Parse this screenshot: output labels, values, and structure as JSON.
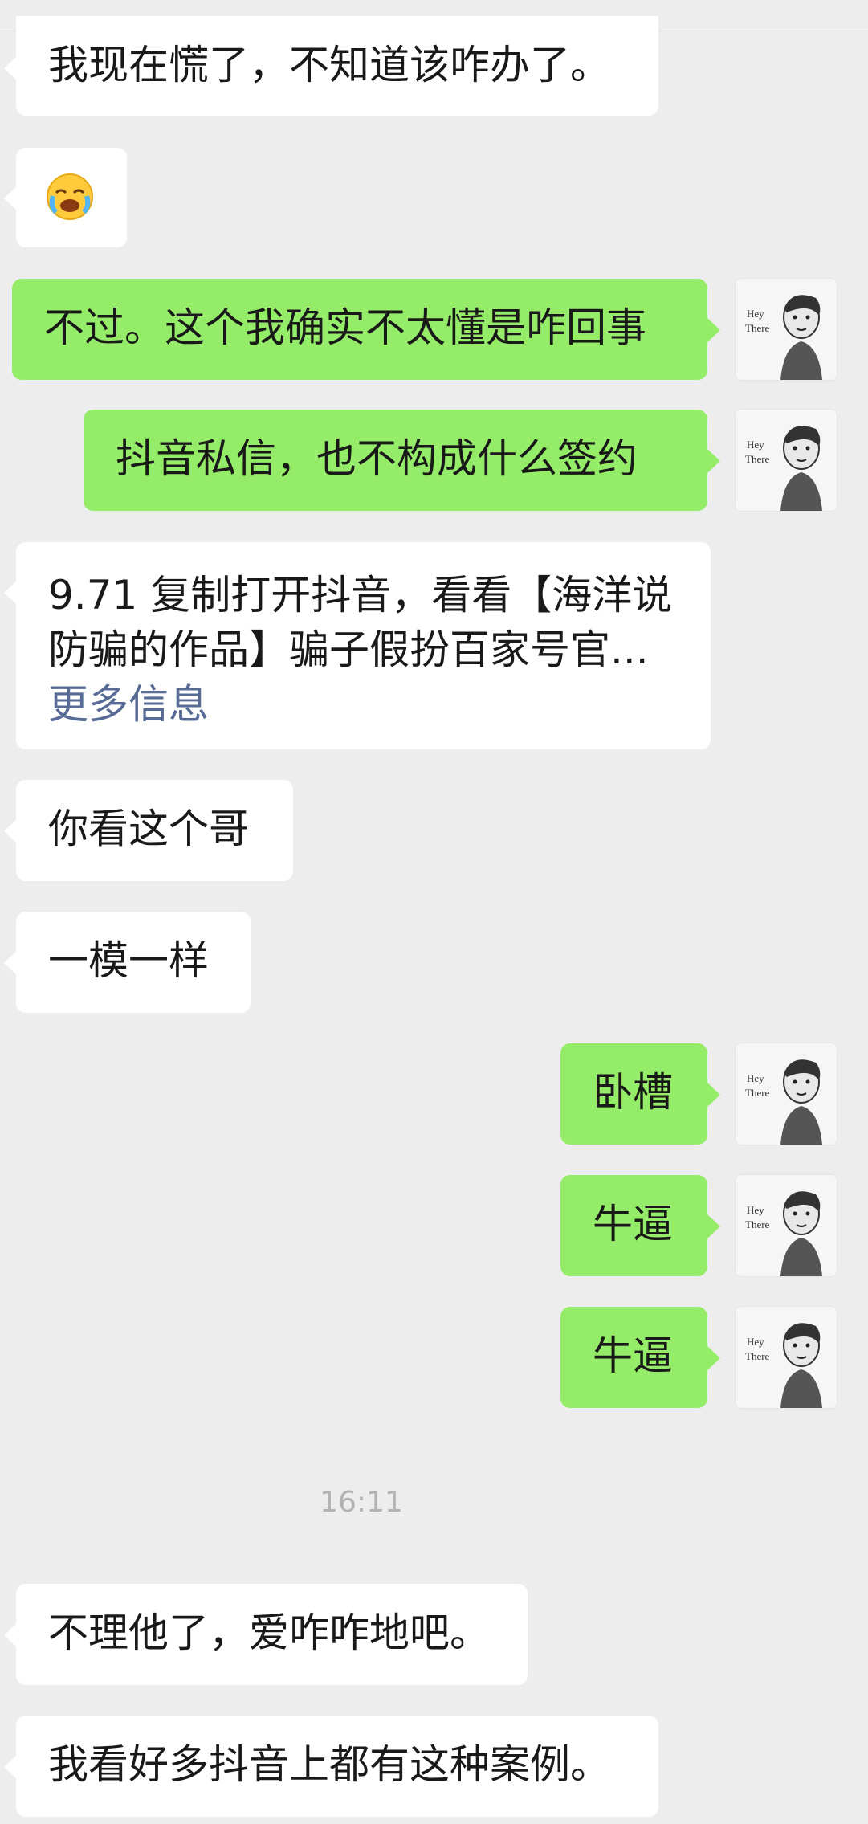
{
  "messages": [
    {
      "side": "in",
      "text": "我现在慌了，不知道该咋办了。"
    },
    {
      "side": "in",
      "text": "😭",
      "emoji": "facepalm-cry"
    },
    {
      "side": "out",
      "text": "不过。这个我确实不太懂是咋回事"
    },
    {
      "side": "out",
      "text": "抖音私信，也不构成什么签约"
    },
    {
      "side": "in",
      "type": "link-card",
      "line1": "9.71 复制打开抖音，看看【海洋说",
      "line2": "防骗的作品】骗子假扮百家号官...",
      "more": "更多信息"
    },
    {
      "side": "in",
      "text": "你看这个哥"
    },
    {
      "side": "in",
      "text": "一模一样"
    },
    {
      "side": "out",
      "text": "卧槽"
    },
    {
      "side": "out",
      "text": "牛逼"
    },
    {
      "side": "out",
      "text": "牛逼"
    },
    {
      "side": "in",
      "text": "不理他了，爱咋咋地吧。"
    },
    {
      "side": "in",
      "text": "我看好多抖音上都有这种案例。"
    }
  ],
  "timestamp": "16:11",
  "avatar": {
    "caption": "Hey There",
    "icon": "caricature-avatar-icon"
  },
  "colors": {
    "background": "#ededed",
    "incoming": "#ffffff",
    "outgoing": "#95ec69",
    "link": "#576b95"
  }
}
